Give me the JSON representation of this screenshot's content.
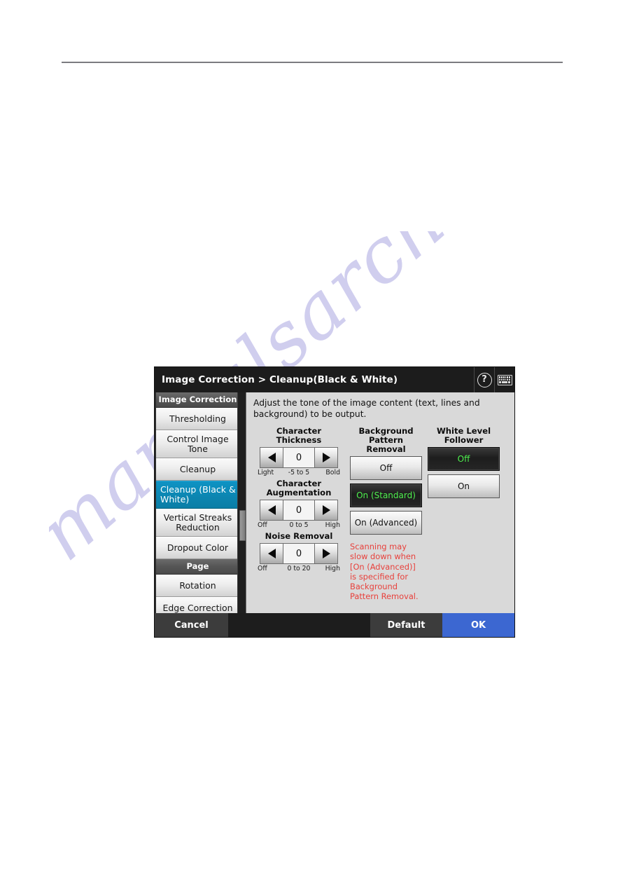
{
  "page": {
    "watermark": "manualsarchive.com"
  },
  "dialog": {
    "titlebar": {
      "breadcrumb": "Image Correction > Cleanup(Black & White)",
      "help_icon": "help-circle-icon",
      "keyboard_icon": "keyboard-icon"
    },
    "sidebar": {
      "items": [
        {
          "label": "Image Correction",
          "type": "section"
        },
        {
          "label": "Thresholding",
          "type": "item",
          "selected": false
        },
        {
          "label": "Control Image Tone",
          "type": "item",
          "selected": false
        },
        {
          "label": "Cleanup",
          "type": "item",
          "selected": false
        },
        {
          "label": "Cleanup (Black & White)",
          "type": "item",
          "selected": true
        },
        {
          "label": "Vertical Streaks Reduction",
          "type": "item",
          "selected": false
        },
        {
          "label": "Dropout Color",
          "type": "item",
          "selected": false
        },
        {
          "label": "Page",
          "type": "section"
        },
        {
          "label": "Rotation",
          "type": "item",
          "selected": false
        },
        {
          "label": "Edge Correction",
          "type": "item",
          "selected": false
        }
      ]
    },
    "panel": {
      "description": "Adjust the tone of the image content (text, lines and background) to be output.",
      "spinners": [
        {
          "label": "Character Thickness",
          "value": "0",
          "legend_left": "Light",
          "legend_center": "-5 to 5",
          "legend_right": "Bold"
        },
        {
          "label": "Character Augmentation",
          "value": "0",
          "legend_left": "Off",
          "legend_center": "0 to 5",
          "legend_right": "High"
        },
        {
          "label": "Noise Removal",
          "value": "0",
          "legend_left": "Off",
          "legend_center": "0 to 20",
          "legend_right": "High"
        }
      ],
      "background_pattern_removal": {
        "label": "Background Pattern Removal",
        "options": [
          {
            "label": "Off",
            "active": false
          },
          {
            "label": "On (Standard)",
            "active": true
          },
          {
            "label": "On (Advanced)",
            "active": false
          }
        ]
      },
      "white_level_follower": {
        "label": "White Level Follower",
        "options": [
          {
            "label": "Off",
            "active": true
          },
          {
            "label": "On",
            "active": false
          }
        ]
      },
      "warning": "Scanning may slow down when [On (Advanced)] is specified for Background Pattern Removal."
    },
    "footer": {
      "cancel": "Cancel",
      "default": "Default",
      "ok": "OK"
    },
    "colors": {
      "accent_selected": "#0e93c4",
      "ok_button": "#3c67d1",
      "active_option_text": "#4ff04f",
      "warning_text": "#e8413c",
      "watermark": "#c8c6ec"
    }
  }
}
